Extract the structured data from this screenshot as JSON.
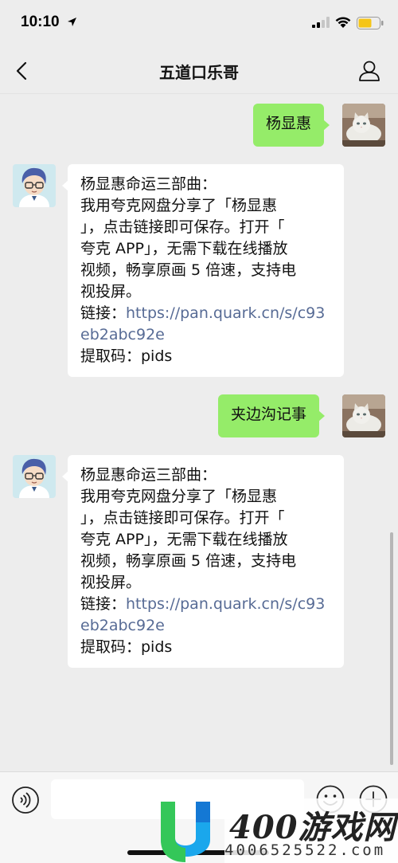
{
  "status_bar": {
    "time": "10:10",
    "icons": [
      "location-arrow-icon",
      "signal-icon",
      "wifi-icon",
      "battery-icon"
    ],
    "battery_color": "#f5c518"
  },
  "nav": {
    "title": "五道口乐哥",
    "back_icon": "chevron-left-icon",
    "right_icon": "person-icon"
  },
  "colors": {
    "background": "#ededed",
    "outgoing_bubble": "#95ec69",
    "incoming_bubble": "#ffffff",
    "link": "#576b95"
  },
  "messages": [
    {
      "direction": "outgoing",
      "text": "杨显惠"
    },
    {
      "direction": "incoming",
      "lines": [
        "杨显惠命运三部曲：",
        "我用夸克网盘分享了「杨显惠",
        "」，点击链接即可保存。打开「",
        "夸克 APP」，无需下载在线播放",
        "视频，畅享原画 5 倍速，支持电",
        "视投屏。"
      ],
      "link_label": "链接：",
      "link_lines": [
        "https://pan.quark.cn/s/c93",
        "eb2abc92e"
      ],
      "code_line": "提取码：pids"
    },
    {
      "direction": "outgoing",
      "text": "夹边沟记事"
    },
    {
      "direction": "incoming",
      "lines": [
        "杨显惠命运三部曲：",
        "我用夸克网盘分享了「杨显惠",
        "」，点击链接即可保存。打开「",
        "夸克 APP」，无需下载在线播放",
        "视频，畅享原画 5 倍速，支持电",
        "视投屏。"
      ],
      "link_label": "链接：",
      "link_lines": [
        "https://pan.quark.cn/s/c93",
        "eb2abc92e"
      ],
      "code_line": "提取码：pids"
    }
  ],
  "input_bar": {
    "placeholder": "",
    "icons": [
      "voice-icon",
      "emoji-icon",
      "plus-icon"
    ]
  },
  "watermark": {
    "brand": "400游戏网",
    "phone": "4006525522.com"
  }
}
